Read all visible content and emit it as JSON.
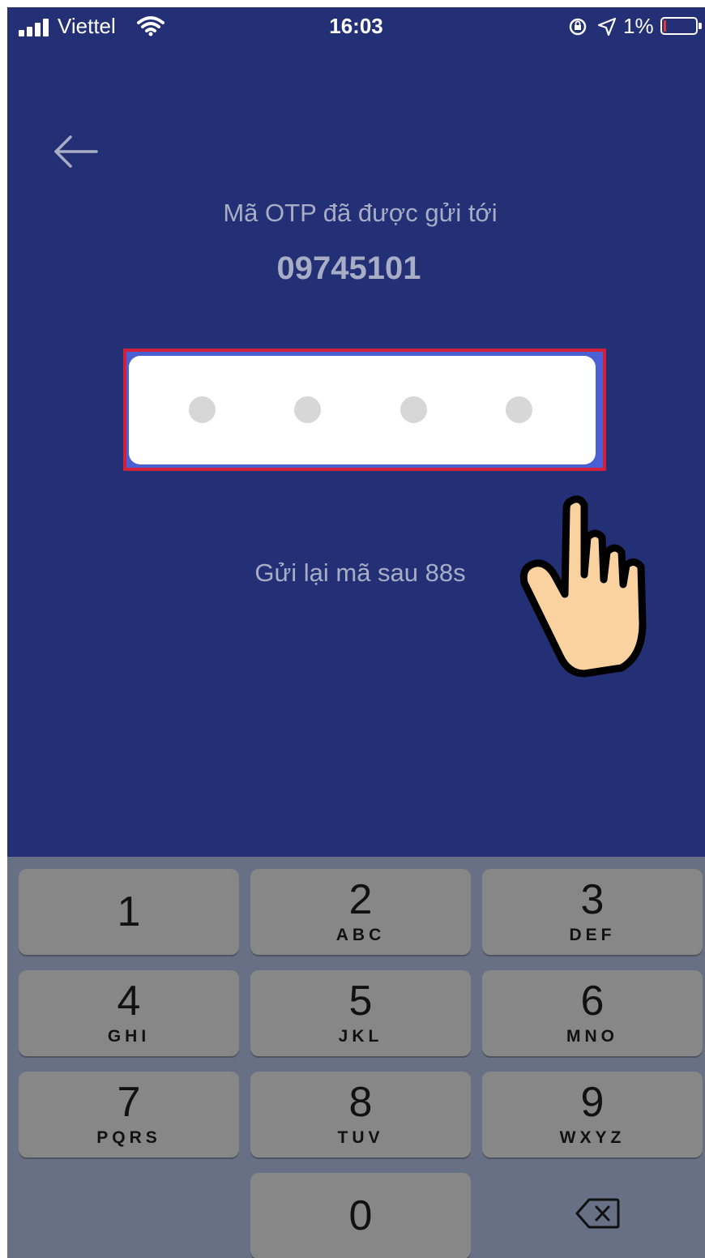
{
  "status_bar": {
    "carrier": "Viettel",
    "time": "16:03",
    "battery_percent": "1%",
    "battery_level": 0.01
  },
  "header": {
    "back_icon": "arrow-left-icon"
  },
  "otp": {
    "title": "Mã OTP đã được gửi tới",
    "phone": "09745101",
    "digits_entered": 0,
    "digit_count": 4
  },
  "resend": {
    "text": "Gửi lại mã sau 88s"
  },
  "keypad": {
    "keys": [
      {
        "num": "1",
        "letters": ""
      },
      {
        "num": "2",
        "letters": "ABC"
      },
      {
        "num": "3",
        "letters": "DEF"
      },
      {
        "num": "4",
        "letters": "GHI"
      },
      {
        "num": "5",
        "letters": "JKL"
      },
      {
        "num": "6",
        "letters": "MNO"
      },
      {
        "num": "7",
        "letters": "PQRS"
      },
      {
        "num": "8",
        "letters": "TUV"
      },
      {
        "num": "9",
        "letters": "WXYZ"
      },
      {
        "num": "0",
        "letters": ""
      }
    ],
    "delete_icon": "backspace-icon"
  },
  "colors": {
    "background": "#233075",
    "highlight_border": "#d1203a",
    "keypad_bg": "#687085",
    "key_bg": "#878787"
  }
}
